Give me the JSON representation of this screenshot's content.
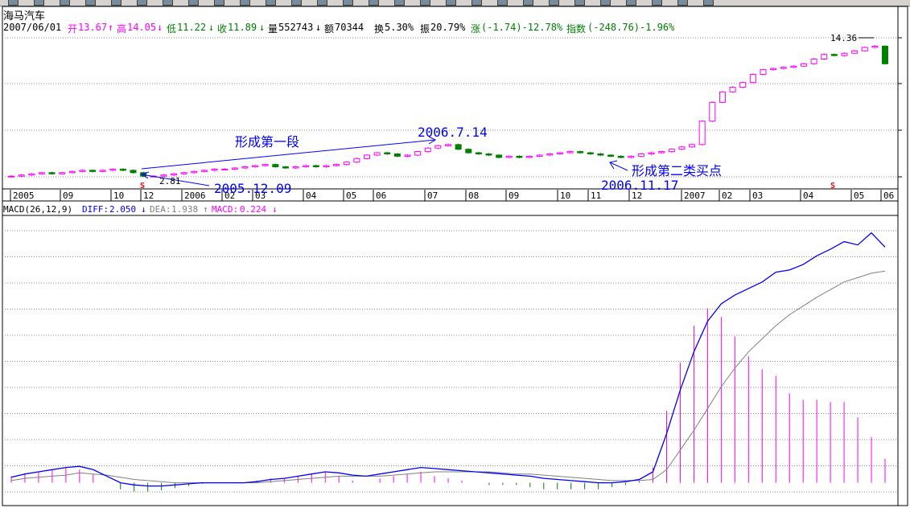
{
  "stock": {
    "name": "海马汽车",
    "date": "2007/06/01"
  },
  "quote": {
    "open_label": "开",
    "open": "13.67",
    "open_arrow": "↑",
    "high_label": "高",
    "high": "14.05",
    "high_arrow": "↓",
    "low_label": "低",
    "low": "11.22",
    "low_arrow": "↓",
    "close_label": "收",
    "close": "11.89",
    "close_arrow": "↓",
    "volume_label": "量",
    "volume": "552743",
    "volume_arrow": "↓",
    "amount_label": "额",
    "amount": "70344",
    "turnover_label": "换",
    "turnover": "5.30%",
    "amplitude_label": "振",
    "amplitude": "20.79%",
    "change_label": "涨",
    "change": "(-1.74)-12.78%",
    "index_label": "指数",
    "index": "(-248.76)-1.96%"
  },
  "macd": {
    "params": "MACD(26,12,9)",
    "diff_label": "DIFF:",
    "diff": "2.050",
    "diff_arrow": "↓",
    "dea_label": "DEA:",
    "dea": "1.938",
    "dea_arrow": "↑",
    "macd_label": "MACD:",
    "macd": "0.224",
    "macd_arrow": "↓"
  },
  "annotations": {
    "first_segment": "形成第一段",
    "second_buy": "形成第二类买点",
    "date_a": "2006.7.14",
    "date_b": "2005.12.09",
    "date_c": "2006.11.17",
    "low_value": "2.81",
    "high_value": "14.36",
    "signal_mark": "S"
  },
  "time_axis": [
    "2005",
    "09",
    "10",
    "12",
    "2006",
    "02",
    "03",
    "04",
    "05",
    "06",
    "07",
    "08",
    "09",
    "10",
    "11",
    "12",
    "2007",
    "02",
    "03",
    "04",
    "05",
    "06"
  ],
  "colors": {
    "up": "#ff00ff",
    "down": "#008000",
    "diff": "#0000ff",
    "dea": "#808080",
    "label_blue": "#0000ff",
    "grid": "#8c8c8c"
  },
  "chart_data": {
    "type": "candlestick",
    "price": [
      2.9,
      3.0,
      3.1,
      3.2,
      3.1,
      3.2,
      3.3,
      3.4,
      3.3,
      3.4,
      3.5,
      3.4,
      3.2,
      2.9,
      2.9,
      3.0,
      3.1,
      3.2,
      3.3,
      3.4,
      3.5,
      3.5,
      3.6,
      3.7,
      3.8,
      3.9,
      3.7,
      3.6,
      3.7,
      3.8,
      3.7,
      3.8,
      3.9,
      4.1,
      4.4,
      4.7,
      4.9,
      4.8,
      4.6,
      4.7,
      5.0,
      5.3,
      5.5,
      5.6,
      5.2,
      4.9,
      4.8,
      4.7,
      4.5,
      4.6,
      4.5,
      4.6,
      4.7,
      4.8,
      4.9,
      5.0,
      4.9,
      4.8,
      4.7,
      4.6,
      4.5,
      4.6,
      4.8,
      4.9,
      5.0,
      5.2,
      5.4,
      5.6,
      7.6,
      9.2,
      10.1,
      10.5,
      10.9,
      11.6,
      12.0,
      12.1,
      12.2,
      12.3,
      12.5,
      12.9,
      13.3,
      13.2,
      13.4,
      13.6,
      13.9,
      14.0,
      12.5
    ],
    "diff": [
      0.05,
      0.08,
      0.1,
      0.12,
      0.14,
      0.15,
      0.12,
      0.06,
      0.0,
      -0.02,
      -0.03,
      -0.03,
      -0.02,
      -0.01,
      0.0,
      0.0,
      0.0,
      0.0,
      0.01,
      0.03,
      0.04,
      0.06,
      0.08,
      0.1,
      0.09,
      0.07,
      0.06,
      0.08,
      0.1,
      0.12,
      0.14,
      0.13,
      0.12,
      0.11,
      0.1,
      0.09,
      0.08,
      0.07,
      0.06,
      0.04,
      0.03,
      0.02,
      0.01,
      0.0,
      0.0,
      0.01,
      0.03,
      0.1,
      0.45,
      0.85,
      1.2,
      1.48,
      1.64,
      1.72,
      1.78,
      1.84,
      1.93,
      1.95,
      2.0,
      2.08,
      2.14,
      2.21,
      2.18,
      2.29,
      2.16
    ],
    "dea": [
      0.02,
      0.04,
      0.05,
      0.06,
      0.07,
      0.09,
      0.08,
      0.07,
      0.05,
      0.03,
      0.02,
      0.01,
      0.0,
      0.0,
      0.0,
      0.0,
      0.0,
      0.0,
      0.0,
      0.01,
      0.02,
      0.03,
      0.04,
      0.05,
      0.06,
      0.06,
      0.06,
      0.06,
      0.07,
      0.08,
      0.09,
      0.1,
      0.1,
      0.1,
      0.1,
      0.1,
      0.09,
      0.08,
      0.08,
      0.07,
      0.06,
      0.05,
      0.04,
      0.03,
      0.02,
      0.02,
      0.02,
      0.03,
      0.12,
      0.3,
      0.48,
      0.68,
      0.88,
      1.05,
      1.2,
      1.32,
      1.44,
      1.54,
      1.62,
      1.7,
      1.77,
      1.84,
      1.88,
      1.92,
      1.94
    ],
    "bars": [
      0.06,
      0.08,
      0.1,
      0.12,
      0.14,
      0.12,
      0.08,
      0.0,
      -0.06,
      -0.08,
      -0.08,
      -0.07,
      -0.05,
      -0.03,
      -0.01,
      0.0,
      0.0,
      0.0,
      0.02,
      0.04,
      0.04,
      0.06,
      0.08,
      0.1,
      0.06,
      0.02,
      0.0,
      0.04,
      0.06,
      0.08,
      0.1,
      0.06,
      0.04,
      0.02,
      0.0,
      -0.02,
      -0.02,
      -0.02,
      -0.04,
      -0.06,
      -0.06,
      -0.06,
      -0.06,
      -0.06,
      -0.04,
      -0.02,
      0.02,
      0.14,
      0.66,
      1.1,
      1.44,
      1.6,
      1.52,
      1.34,
      1.16,
      1.04,
      0.98,
      0.82,
      0.76,
      0.76,
      0.74,
      0.74,
      0.6,
      0.42,
      0.22
    ],
    "price_range": [
      2.5,
      15.2
    ],
    "macd_range": [
      -0.18,
      2.45
    ]
  }
}
